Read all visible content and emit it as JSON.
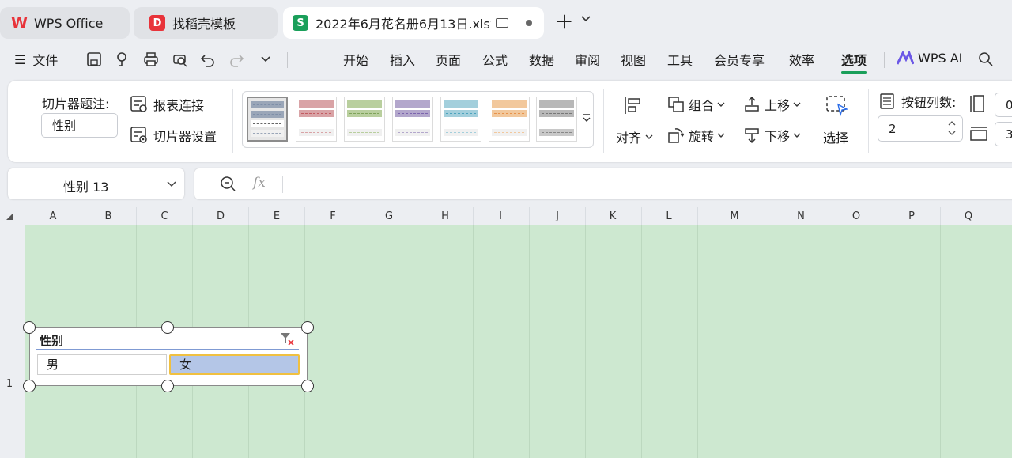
{
  "tabs": [
    {
      "label": "WPS Office"
    },
    {
      "label": "找稻壳模板"
    },
    {
      "label": "2022年6月花名册6月13日.xlsx"
    }
  ],
  "titlebar": {
    "new_tab": "+",
    "tab_dropdown": "⌄"
  },
  "menubar": {
    "file": "文件",
    "items": [
      "开始",
      "插入",
      "页面",
      "公式",
      "数据",
      "审阅",
      "视图",
      "工具",
      "会员专享",
      "效率",
      "选项"
    ],
    "active": "选项",
    "wps_ai": "WPS AI"
  },
  "ribbon": {
    "caption_label": "切片器题注:",
    "caption_value": "性别",
    "report_connect": "报表连接",
    "slicer_settings": "切片器设置",
    "align": "对齐",
    "group": "组合",
    "rotate": "旋转",
    "move_up": "上移",
    "move_down": "下移",
    "select": "选择",
    "button_cols_label": "按钮列数:",
    "button_cols_value": "2",
    "height_value": "0",
    "width_value": "3"
  },
  "formula_bar": {
    "name_box": "性别 13",
    "fx": "fx",
    "content": ""
  },
  "columns": [
    "A",
    "B",
    "C",
    "D",
    "E",
    "F",
    "G",
    "H",
    "I",
    "J",
    "K",
    "L",
    "M",
    "N",
    "O",
    "P",
    "Q"
  ],
  "rows": [
    "1"
  ],
  "slicer": {
    "title": "性别",
    "items": [
      {
        "label": "男",
        "selected": false
      },
      {
        "label": "女",
        "selected": true
      }
    ]
  },
  "colors": {
    "accent": "#1a9f5a",
    "grid_bg": "#cde8d0",
    "selected_item": "#b4c6e7",
    "selected_border": "#f0c040",
    "wps_red": "#e8333a"
  }
}
